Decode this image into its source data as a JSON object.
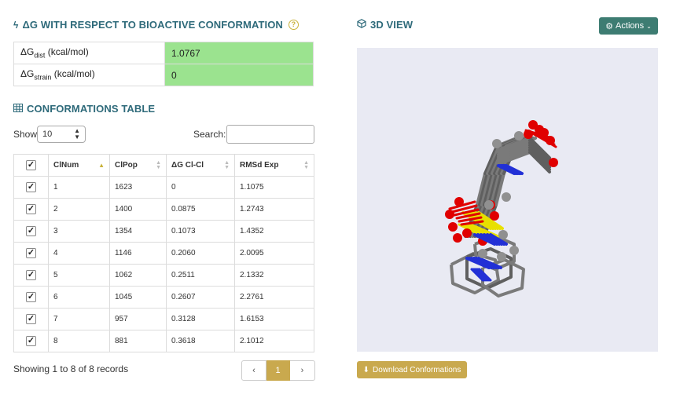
{
  "delta_g": {
    "title": "ΔG WITH RESPECT TO BIOACTIVE CONFORMATION",
    "rows": [
      {
        "label_main": "ΔG",
        "label_sub": "dist",
        "label_unit": " (kcal/mol)",
        "value": "1.0767"
      },
      {
        "label_main": "ΔG",
        "label_sub": "strain",
        "label_unit": " (kcal/mol)",
        "value": "0"
      }
    ]
  },
  "conformations": {
    "title": "CONFORMATIONS TABLE",
    "show_label": "Show",
    "show_value": "10",
    "search_label": "Search:",
    "search_value": "",
    "columns": [
      "ClNum",
      "ClPop",
      "ΔG Cl-Cl",
      "RMSd Exp"
    ],
    "rows": [
      [
        "1",
        "1623",
        "0",
        "1.1075"
      ],
      [
        "2",
        "1400",
        "0.0875",
        "1.2743"
      ],
      [
        "3",
        "1354",
        "0.1073",
        "1.4352"
      ],
      [
        "4",
        "1146",
        "0.2060",
        "2.0095"
      ],
      [
        "5",
        "1062",
        "0.2511",
        "2.1332"
      ],
      [
        "6",
        "1045",
        "0.2607",
        "2.2761"
      ],
      [
        "7",
        "957",
        "0.3128",
        "1.6153"
      ],
      [
        "8",
        "881",
        "0.3618",
        "2.1012"
      ]
    ],
    "records_text": "Showing 1 to 8 of 8 records",
    "pager": {
      "prev": "‹",
      "page": "1",
      "next": "›"
    }
  },
  "view3d": {
    "title": "3D VIEW",
    "actions_label": "Actions",
    "download_label": "Download Conformations"
  },
  "colors": {
    "accent": "#2e6a7a",
    "value_bg": "#9be38f",
    "gold": "#c9a94e",
    "actions_bg": "#3d7c72",
    "viewer_bg": "#e9eaf3",
    "carbon": "#7a7a7a",
    "oxygen": "#e00000",
    "nitrogen": "#2230d6",
    "sulfur": "#e8e000"
  }
}
